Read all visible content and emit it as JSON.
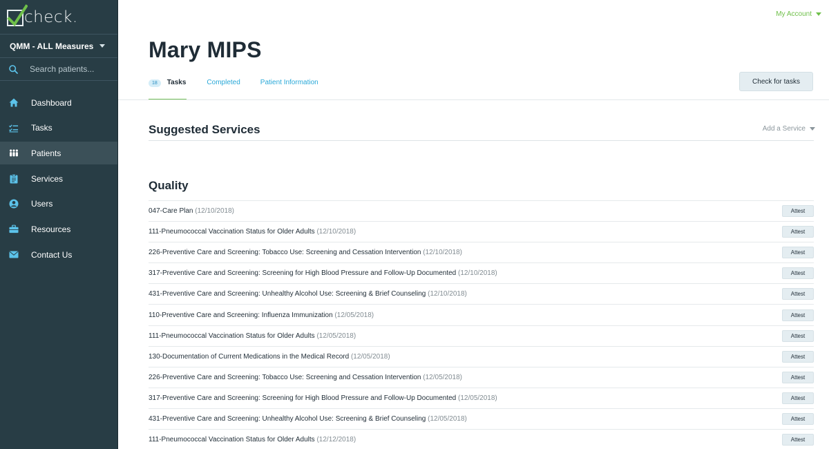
{
  "brand": {
    "logo_text": "check."
  },
  "sidebar": {
    "measure_selector": {
      "label": "QMM - ALL Measures"
    },
    "search": {
      "placeholder": "Search patients..."
    },
    "items": [
      {
        "label": "Dashboard",
        "icon": "home-icon",
        "active": false
      },
      {
        "label": "Tasks",
        "icon": "checklist-icon",
        "active": false
      },
      {
        "label": "Patients",
        "icon": "people-icon",
        "active": true
      },
      {
        "label": "Services",
        "icon": "clipboard-icon",
        "active": false
      },
      {
        "label": "Users",
        "icon": "user-circle-icon",
        "active": false
      },
      {
        "label": "Resources",
        "icon": "briefcase-icon",
        "active": false
      },
      {
        "label": "Contact Us",
        "icon": "envelope-icon",
        "active": false
      }
    ]
  },
  "header": {
    "account_label": "My Account",
    "patient_name": "Mary MIPS",
    "tabs": [
      {
        "label": "Tasks",
        "badge": "18",
        "active": true
      },
      {
        "label": "Completed",
        "active": false
      },
      {
        "label": "Patient Information",
        "active": false
      }
    ],
    "check_button_label": "Check for tasks"
  },
  "suggested_services": {
    "title": "Suggested Services",
    "add_service_label": "Add a Service"
  },
  "quality": {
    "title": "Quality",
    "attest_label": "Attest",
    "rows": [
      {
        "name": "047-Care Plan",
        "date": "(12/10/2018)"
      },
      {
        "name": "111-Pneumococcal Vaccination Status for Older Adults",
        "date": "(12/10/2018)"
      },
      {
        "name": "226-Preventive Care and Screening: Tobacco Use: Screening and Cessation Intervention",
        "date": "(12/10/2018)"
      },
      {
        "name": "317-Preventive Care and Screening: Screening for High Blood Pressure and Follow-Up Documented",
        "date": "(12/10/2018)"
      },
      {
        "name": "431-Preventive Care and Screening: Unhealthy Alcohol Use: Screening & Brief Counseling",
        "date": "(12/10/2018)"
      },
      {
        "name": "110-Preventive Care and Screening: Influenza Immunization",
        "date": "(12/05/2018)"
      },
      {
        "name": "111-Pneumococcal Vaccination Status for Older Adults",
        "date": "(12/05/2018)"
      },
      {
        "name": "130-Documentation of Current Medications in the Medical Record",
        "date": "(12/05/2018)"
      },
      {
        "name": "226-Preventive Care and Screening: Tobacco Use: Screening and Cessation Intervention",
        "date": "(12/05/2018)"
      },
      {
        "name": "317-Preventive Care and Screening: Screening for High Blood Pressure and Follow-Up Documented",
        "date": "(12/05/2018)"
      },
      {
        "name": "431-Preventive Care and Screening: Unhealthy Alcohol Use: Screening & Brief Counseling",
        "date": "(12/05/2018)"
      },
      {
        "name": "111-Pneumococcal Vaccination Status for Older Adults",
        "date": "(12/12/2018)"
      }
    ]
  },
  "colors": {
    "sidebar_bg": "#283d45",
    "sidebar_active": "#3b5058",
    "accent_green": "#6fc04a",
    "link_blue": "#29a8d8",
    "icon_blue": "#5cc3ea"
  }
}
